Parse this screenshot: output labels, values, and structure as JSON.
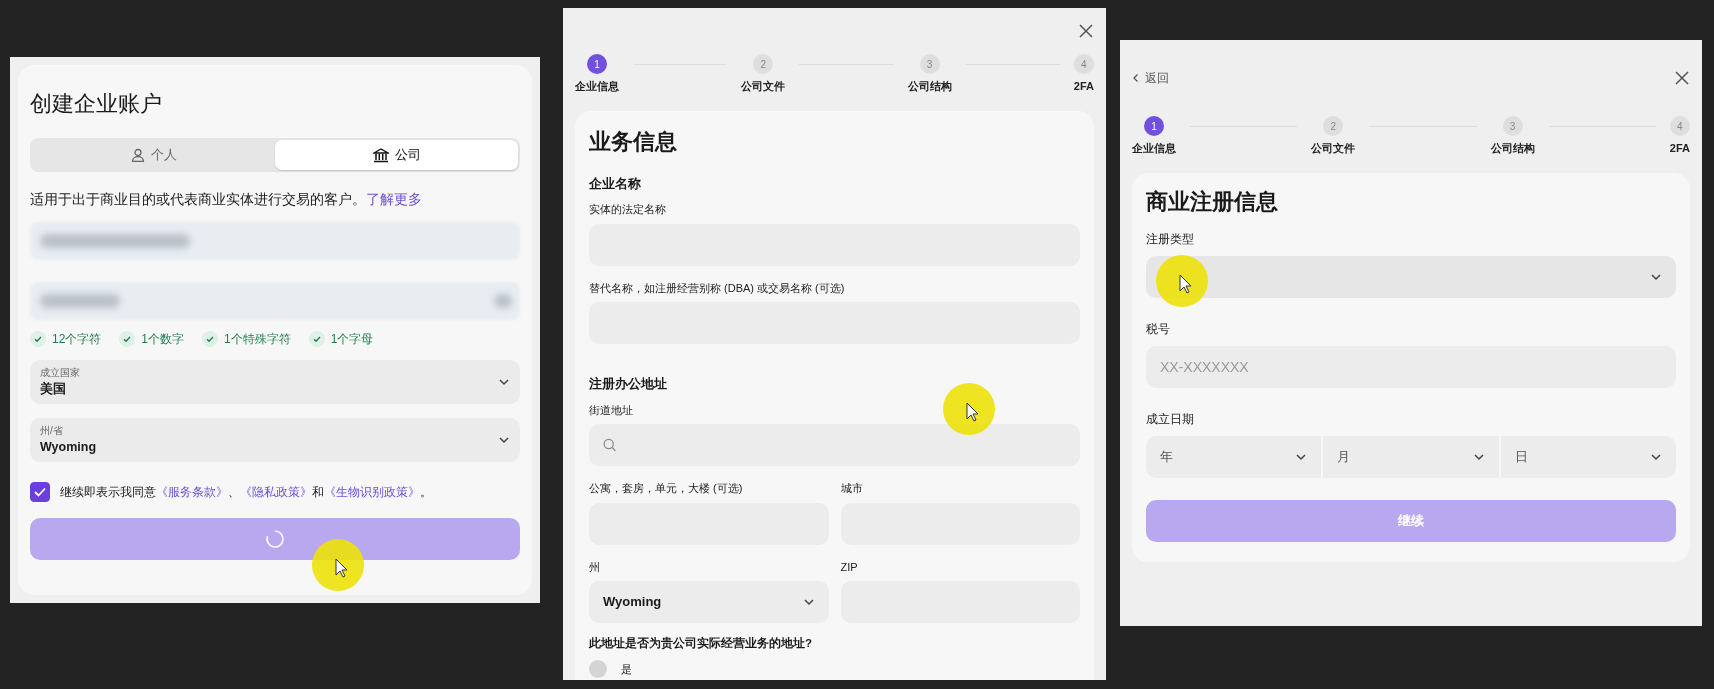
{
  "account_panel": {
    "title": "创建企业账户",
    "account_types": [
      {
        "label": "个人",
        "kind": "personal",
        "selected": false
      },
      {
        "label": "公司",
        "kind": "company",
        "selected": true
      }
    ],
    "description": [
      {
        "text": "适用于出于商业目的或代表商业实体进行交易的客户。",
        "link": false
      },
      {
        "text": "了解更多",
        "link": true
      }
    ],
    "redacted_fields": [
      {
        "kind": "text"
      },
      {
        "kind": "password"
      }
    ],
    "password_rules": [
      {
        "label": "12个字符",
        "met": true
      },
      {
        "label": "1个数字",
        "met": true
      },
      {
        "label": "1个特殊字符",
        "met": true
      },
      {
        "label": "1个字母",
        "met": true
      }
    ],
    "selects": [
      {
        "label": "成立国家",
        "value": "美国"
      },
      {
        "label": "州/省",
        "value": "Wyoming"
      }
    ],
    "agreement": {
      "checked": true,
      "parts": [
        {
          "text": "继续即表示我同意",
          "link": false
        },
        {
          "text": "《服务条款》",
          "link": true
        },
        {
          "text": "、",
          "link": false
        },
        {
          "text": "《隐私政策》",
          "link": true
        },
        {
          "text": "和",
          "link": false
        },
        {
          "text": "《生物识别政策》",
          "link": true
        },
        {
          "text": "。",
          "link": false
        }
      ]
    },
    "submit": {
      "loading": true
    }
  },
  "business_info_panel": {
    "steps": [
      {
        "number": "1",
        "label": "企业信息",
        "selected": true
      },
      {
        "number": "2",
        "label": "公司文件",
        "selected": false
      },
      {
        "number": "3",
        "label": "公司结构",
        "selected": false
      },
      {
        "number": "4",
        "label": "2FA",
        "selected": false
      }
    ],
    "title": "业务信息",
    "sections": [
      {
        "heading": "企业名称",
        "rows": [
          [
            {
              "label": "实体的法定名称",
              "kind": "text"
            }
          ],
          [
            {
              "label": "替代名称，如注册经营别称 (DBA) 或交易名称 (可选)",
              "kind": "text"
            }
          ]
        ]
      },
      {
        "heading": "注册办公地址",
        "rows": [
          [
            {
              "label": "街道地址",
              "kind": "search"
            }
          ],
          [
            {
              "label": "公寓，套房，单元，大楼 (可选)",
              "kind": "text"
            },
            {
              "label": "城市",
              "kind": "text"
            }
          ],
          [
            {
              "label": "州",
              "kind": "select",
              "value": "Wyoming"
            },
            {
              "label": "ZIP",
              "kind": "text"
            }
          ]
        ]
      }
    ],
    "question": "此地址是否为贵公司实际经营业务的地址?",
    "options": [
      {
        "label": "是",
        "selected": false
      }
    ]
  },
  "registration_panel": {
    "back": "返回",
    "steps": [
      {
        "number": "1",
        "label": "企业信息",
        "selected": true
      },
      {
        "number": "2",
        "label": "公司文件",
        "selected": false
      },
      {
        "number": "3",
        "label": "公司结构",
        "selected": false
      },
      {
        "number": "4",
        "label": "2FA",
        "selected": false
      }
    ],
    "title": "商业注册信息",
    "fields": [
      {
        "label": "注册类型",
        "kind": "select"
      },
      {
        "label": "税号",
        "kind": "text",
        "placeholder": "XX-XXXXXXX"
      },
      {
        "label": "成立日期",
        "kind": "date",
        "parts": [
          {
            "placeholder": "年"
          },
          {
            "placeholder": "月"
          },
          {
            "placeholder": "日"
          }
        ]
      }
    ],
    "submit": {
      "label": "继续",
      "disabled": true
    }
  }
}
